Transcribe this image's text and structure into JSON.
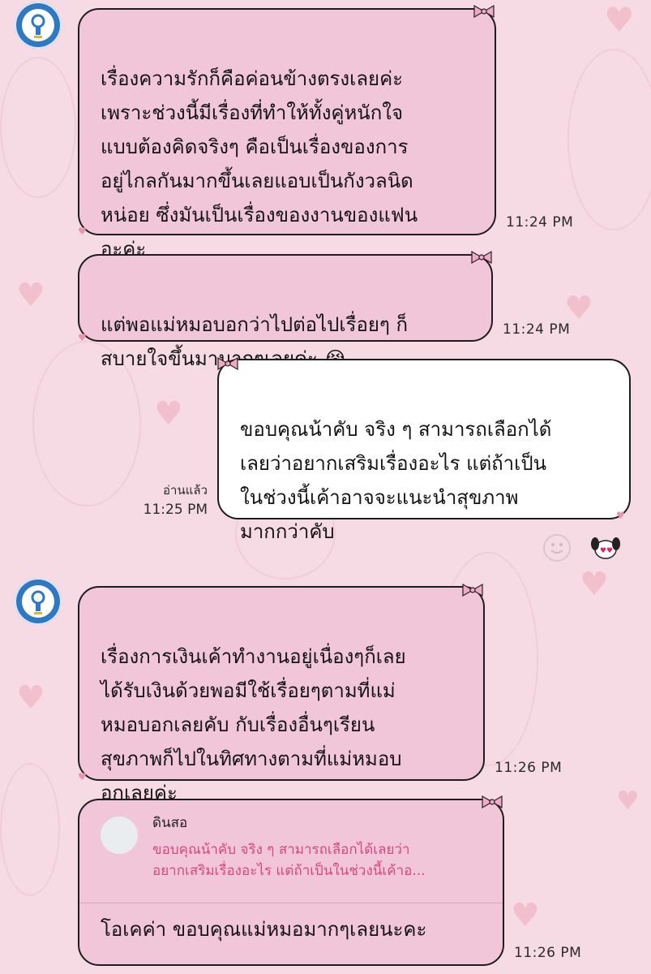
{
  "colors": {
    "background": "#f6dbe4",
    "incoming_bubble": "#f0c6d8",
    "outgoing_bubble": "#ffffff",
    "reply_quote_text": "#d6487e",
    "avatar_blue": "#2f78c4"
  },
  "messages": [
    {
      "side": "in",
      "text": "เรื่องความรักก็คือค่อนข้างตรงเลยค่ะ\nเพราะช่วงนี้มีเรื่องที่ทำให้ทั้งคู่หนักใจ\nแบบต้องคิดจริงๆ คือเป็นเรื่องของการ\nอยู่ไกลกันมากขึ้นเลยแอบเป็นกังวลนิด\nหน่อย ซึ่งมันเป็นเรื่องของงานของแฟน\nอะค่ะ",
      "time": "11:24 PM"
    },
    {
      "side": "in",
      "text": "แต่พอแม่หมอบอกว่าไปต่อไปเรื่อยๆ ก็\nสบายใจขึ้นมามากๆเลยค่ะ 😭",
      "time": "11:24 PM"
    },
    {
      "side": "out",
      "text": "ขอบคุณน้าคับ จริง ๆ สามารถเลือกได้\nเลยว่าอยากเสริมเรื่องอะไร แต่ถ้าเป็น\nในช่วงนี้เค้าอาจจะแนะนำสุขภาพ\nมากกว่าคับ",
      "read_label": "อ่านแล้ว",
      "time": "11:25 PM"
    },
    {
      "side": "in",
      "text": "เรื่องการเงินเค้าทำงานอยู่เนื่องๆก็เลย\nได้รับเงินด้วยพอมีใช้เรื่อยๆตามที่แม่\nหมอบอกเลยคับ กับเรื่องอื่นๆเรียน\nสุขภาพก็ไปในทิศทางตามที่แม่หมอบ\nอกเลยค่ะ",
      "time": "11:26 PM"
    },
    {
      "side": "in",
      "reply_to": {
        "name": "ดินสอ",
        "quote": "ขอบคุณน้าคับ จริง ๆ สามารถเลือกได้เลยว่า\nอยากเสริมเรื่องอะไร แต่ถ้าเป็นในช่วงนี้เค้าอ..."
      },
      "text": "โอเคค่า ขอบคุณแม่หมอมากๆเลยนะคะ",
      "time": "11:26 PM"
    }
  ],
  "icons": {
    "contact_avatar": "lightbulb-icon",
    "reaction": "smile-icon",
    "sticker": "puppy-sticker-icon",
    "bubble_decoration": "ribbon-bow-icon"
  }
}
